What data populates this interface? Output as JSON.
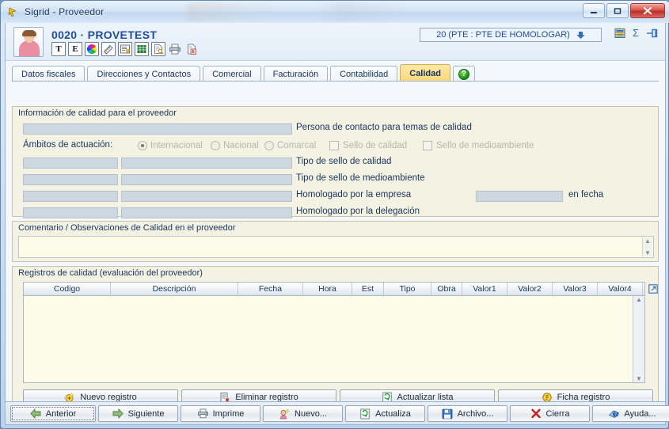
{
  "window": {
    "title": "Sigrid - Proveedor",
    "buttons": {
      "minimize": "—",
      "maximize": "▢",
      "close": "✕"
    }
  },
  "header": {
    "record_title": "0020 · PROVETEST",
    "toolbar_icons": [
      {
        "name": "text-icon",
        "glyph": "T"
      },
      {
        "name": "email-icon",
        "glyph": "E"
      },
      {
        "name": "color-wheel-icon",
        "glyph": ""
      },
      {
        "name": "palette-icon",
        "glyph": ""
      },
      {
        "name": "notes-icon",
        "glyph": ""
      },
      {
        "name": "spreadsheet-icon",
        "glyph": ""
      },
      {
        "name": "preview-document-icon",
        "glyph": ""
      },
      {
        "name": "printer-icon",
        "glyph": ""
      },
      {
        "name": "pdf-icon",
        "glyph": ""
      }
    ],
    "status_value": "20 (PTE : PTE DE HOMOLOGAR)",
    "status_arrow": "⇩",
    "right_icons": [
      {
        "name": "grid-report-icon"
      },
      {
        "name": "sigma-icon",
        "glyph": "Σ"
      },
      {
        "name": "pin-icon"
      }
    ]
  },
  "tabs": [
    {
      "label": "Datos fiscales",
      "active": false
    },
    {
      "label": "Direcciones y Contactos",
      "active": false
    },
    {
      "label": "Comercial",
      "active": false
    },
    {
      "label": "Facturación",
      "active": false
    },
    {
      "label": "Contabilidad",
      "active": false
    },
    {
      "label": "Calidad",
      "active": true
    }
  ],
  "help_tab": {
    "glyph": "?"
  },
  "quality_panel": {
    "legend": "Información de calidad para el proveedor",
    "contact_field_value": "",
    "contact_label": "Persona de contacto para temas de calidad",
    "scope_label": "Ámbitos de actuación:",
    "radios": [
      {
        "label": "Internacional",
        "selected": true
      },
      {
        "label": "Nacional",
        "selected": false
      },
      {
        "label": "Comarcal",
        "selected": false
      }
    ],
    "checkboxes": [
      {
        "label": "Sello de calidad",
        "checked": false
      },
      {
        "label": "Sello de medioambiente",
        "checked": false
      }
    ],
    "rows": [
      {
        "code": "",
        "value": "",
        "label": "Tipo de sello de calidad"
      },
      {
        "code": "",
        "value": "",
        "label": "Tipo de sello de medioambiente"
      },
      {
        "code": "",
        "value": "",
        "label": "Homologado por la empresa",
        "extra_field": "",
        "extra_label": "en fecha"
      },
      {
        "code": "",
        "value": "",
        "label": "Homologado por la delegación"
      }
    ]
  },
  "comment_panel": {
    "legend": "Comentario / Observaciones de Calidad en el proveedor",
    "value": "",
    "scroll_up": "▲",
    "scroll_down": "▼"
  },
  "records_panel": {
    "legend": "Registros de calidad (evaluación del proveedor)",
    "columns": [
      {
        "label": "Codigo",
        "width": 110
      },
      {
        "label": "Descripción",
        "width": 161
      },
      {
        "label": "Fecha",
        "width": 82
      },
      {
        "label": "Hora",
        "width": 62
      },
      {
        "label": "Est",
        "width": 40
      },
      {
        "label": "Tipo",
        "width": 60
      },
      {
        "label": "Obra",
        "width": 39
      },
      {
        "label": "Valor1",
        "width": 57
      },
      {
        "label": "Valor2",
        "width": 57
      },
      {
        "label": "Valor3",
        "width": 57
      },
      {
        "label": "Valor4",
        "width": 57
      }
    ],
    "rows": [],
    "expand_icon": "expand-grid-icon",
    "scroll_up": "▲",
    "scroll_down": "▼"
  },
  "record_actions": [
    {
      "label": "Nuevo registro",
      "icon": "new-record-icon"
    },
    {
      "label": "Eliminar registro",
      "icon": "delete-record-icon"
    },
    {
      "label": "Actualizar lista",
      "icon": "refresh-icon"
    },
    {
      "label": "Ficha registro",
      "icon": "record-card-icon"
    }
  ],
  "bottom_bar": [
    {
      "label": "Anterior",
      "icon": "arrow-left-icon",
      "focused": true
    },
    {
      "label": "Siguiente",
      "icon": "arrow-right-icon",
      "focused": false
    },
    {
      "label": "Imprime",
      "icon": "printer-icon",
      "focused": false
    },
    {
      "label": "Nuevo...",
      "icon": "new-supplier-icon",
      "focused": false
    },
    {
      "label": "Actualiza",
      "icon": "refresh-icon",
      "focused": false
    },
    {
      "label": "Archivo...",
      "icon": "save-icon",
      "focused": false
    },
    {
      "label": "Cierra",
      "icon": "close-x-icon",
      "focused": false
    },
    {
      "label": "Ayuda...",
      "icon": "help-icon",
      "focused": false
    }
  ],
  "colors": {
    "accent_blue": "#1f4e9c",
    "active_tab": "#f8d77a",
    "panel_bg": "#f4f2e3",
    "field_bg": "#ccd7e0",
    "input_bg": "#fdfce9",
    "close_red": "#b93029"
  }
}
